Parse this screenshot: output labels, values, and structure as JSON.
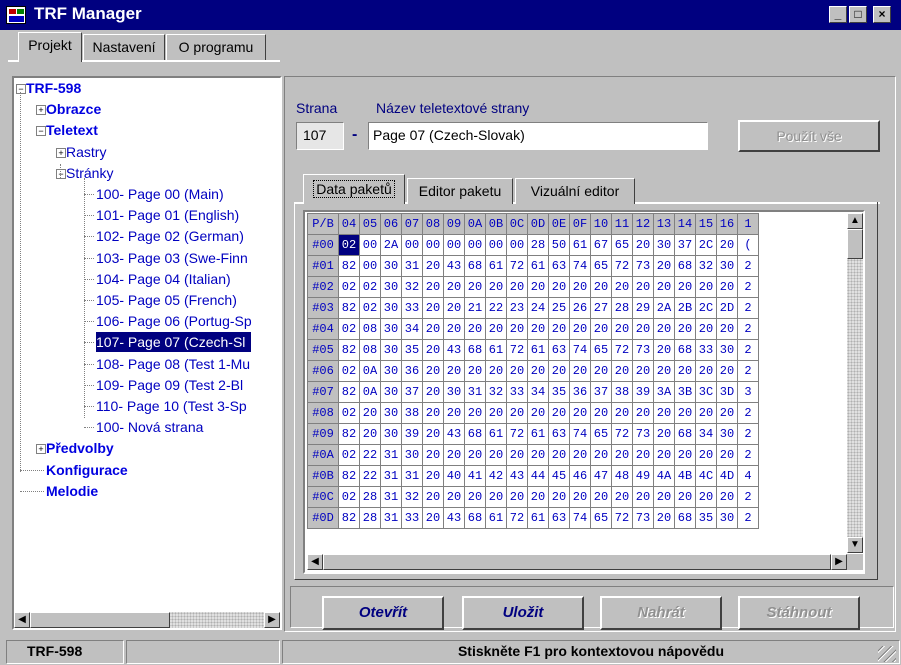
{
  "window": {
    "title": "TRF Manager",
    "buttons": [
      "_",
      "□",
      "×"
    ]
  },
  "tabs": [
    "Projekt",
    "Nastavení",
    "O programu"
  ],
  "tree": [
    {
      "label": "TRF-598",
      "style": "b",
      "expander": "minus"
    },
    {
      "label": "Obrazce",
      "style": "b",
      "expander": "plus"
    },
    {
      "label": "Teletext",
      "style": "b",
      "expander": "minus"
    },
    {
      "label": "Rastry",
      "style": "n",
      "expander": "plus"
    },
    {
      "label": "Stránky",
      "style": "n",
      "expander": "minus"
    },
    {
      "label": "100- Page 00 (Main)",
      "style": "n"
    },
    {
      "label": "101- Page 01 (English)",
      "style": "n"
    },
    {
      "label": "102- Page 02 (German)",
      "style": "n"
    },
    {
      "label": "103- Page 03 (Swe-Finn",
      "style": "n"
    },
    {
      "label": "104- Page 04 (Italian)",
      "style": "n"
    },
    {
      "label": "105- Page 05 (French)",
      "style": "n"
    },
    {
      "label": "106- Page 06 (Portug-Sp",
      "style": "n"
    },
    {
      "label": "107- Page 07 (Czech-Sl",
      "style": "n",
      "selected": true
    },
    {
      "label": "108- Page 08 (Test 1-Mu",
      "style": "n"
    },
    {
      "label": "109- Page 09 (Test 2-Bl",
      "style": "n"
    },
    {
      "label": "110- Page 10 (Test 3-Sp",
      "style": "n"
    },
    {
      "label": "100- Nová strana",
      "style": "n"
    },
    {
      "label": "Předvolby",
      "style": "b",
      "expander": "plus"
    },
    {
      "label": "Konfigurace",
      "style": "b"
    },
    {
      "label": "Melodie",
      "style": "b"
    }
  ],
  "page": {
    "strana_label": "Strana",
    "name_label": "Název teletextové strany",
    "number": "107",
    "dash": "-",
    "name": "Page 07 (Czech-Slovak)",
    "apply_all": "Použít vše"
  },
  "subtabs": [
    "Data paketů",
    "Editor paketu",
    "Vizuální editor"
  ],
  "grid": {
    "corner": "P/B",
    "columns": [
      "04",
      "05",
      "06",
      "07",
      "08",
      "09",
      "0A",
      "0B",
      "0C",
      "0D",
      "0E",
      "0F",
      "10",
      "11",
      "12",
      "13",
      "14",
      "15",
      "16",
      "1"
    ],
    "rows": [
      {
        "id": "#00",
        "cells": [
          "02",
          "00",
          "2A",
          "00",
          "00",
          "00",
          "00",
          "00",
          "00",
          "28",
          "50",
          "61",
          "67",
          "65",
          "20",
          "30",
          "37",
          "2C",
          "20",
          "("
        ]
      },
      {
        "id": "#01",
        "cells": [
          "82",
          "00",
          "30",
          "31",
          "20",
          "43",
          "68",
          "61",
          "72",
          "61",
          "63",
          "74",
          "65",
          "72",
          "73",
          "20",
          "68",
          "32",
          "30",
          "2"
        ]
      },
      {
        "id": "#02",
        "cells": [
          "02",
          "02",
          "30",
          "32",
          "20",
          "20",
          "20",
          "20",
          "20",
          "20",
          "20",
          "20",
          "20",
          "20",
          "20",
          "20",
          "20",
          "20",
          "20",
          "2"
        ]
      },
      {
        "id": "#03",
        "cells": [
          "82",
          "02",
          "30",
          "33",
          "20",
          "20",
          "21",
          "22",
          "23",
          "24",
          "25",
          "26",
          "27",
          "28",
          "29",
          "2A",
          "2B",
          "2C",
          "2D",
          "2"
        ]
      },
      {
        "id": "#04",
        "cells": [
          "02",
          "08",
          "30",
          "34",
          "20",
          "20",
          "20",
          "20",
          "20",
          "20",
          "20",
          "20",
          "20",
          "20",
          "20",
          "20",
          "20",
          "20",
          "20",
          "2"
        ]
      },
      {
        "id": "#05",
        "cells": [
          "82",
          "08",
          "30",
          "35",
          "20",
          "43",
          "68",
          "61",
          "72",
          "61",
          "63",
          "74",
          "65",
          "72",
          "73",
          "20",
          "68",
          "33",
          "30",
          "2"
        ]
      },
      {
        "id": "#06",
        "cells": [
          "02",
          "0A",
          "30",
          "36",
          "20",
          "20",
          "20",
          "20",
          "20",
          "20",
          "20",
          "20",
          "20",
          "20",
          "20",
          "20",
          "20",
          "20",
          "20",
          "2"
        ]
      },
      {
        "id": "#07",
        "cells": [
          "82",
          "0A",
          "30",
          "37",
          "20",
          "30",
          "31",
          "32",
          "33",
          "34",
          "35",
          "36",
          "37",
          "38",
          "39",
          "3A",
          "3B",
          "3C",
          "3D",
          "3"
        ]
      },
      {
        "id": "#08",
        "cells": [
          "02",
          "20",
          "30",
          "38",
          "20",
          "20",
          "20",
          "20",
          "20",
          "20",
          "20",
          "20",
          "20",
          "20",
          "20",
          "20",
          "20",
          "20",
          "20",
          "2"
        ]
      },
      {
        "id": "#09",
        "cells": [
          "82",
          "20",
          "30",
          "39",
          "20",
          "43",
          "68",
          "61",
          "72",
          "61",
          "63",
          "74",
          "65",
          "72",
          "73",
          "20",
          "68",
          "34",
          "30",
          "2"
        ]
      },
      {
        "id": "#0A",
        "cells": [
          "02",
          "22",
          "31",
          "30",
          "20",
          "20",
          "20",
          "20",
          "20",
          "20",
          "20",
          "20",
          "20",
          "20",
          "20",
          "20",
          "20",
          "20",
          "20",
          "2"
        ]
      },
      {
        "id": "#0B",
        "cells": [
          "82",
          "22",
          "31",
          "31",
          "20",
          "40",
          "41",
          "42",
          "43",
          "44",
          "45",
          "46",
          "47",
          "48",
          "49",
          "4A",
          "4B",
          "4C",
          "4D",
          "4"
        ]
      },
      {
        "id": "#0C",
        "cells": [
          "02",
          "28",
          "31",
          "32",
          "20",
          "20",
          "20",
          "20",
          "20",
          "20",
          "20",
          "20",
          "20",
          "20",
          "20",
          "20",
          "20",
          "20",
          "20",
          "2"
        ]
      },
      {
        "id": "#0D",
        "cells": [
          "82",
          "28",
          "31",
          "33",
          "20",
          "43",
          "68",
          "61",
          "72",
          "61",
          "63",
          "74",
          "65",
          "72",
          "73",
          "20",
          "68",
          "35",
          "30",
          "2"
        ]
      }
    ]
  },
  "buttons": {
    "open": "Otevřít",
    "save": "Uložit",
    "upload": "Nahrát",
    "download": "Stáhnout"
  },
  "status": {
    "left": "TRF-598",
    "center": "Stiskněte F1 pro kontextovou nápovědu"
  }
}
